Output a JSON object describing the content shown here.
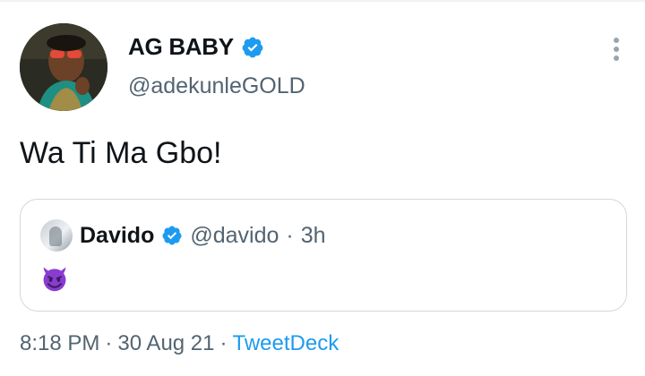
{
  "author": {
    "display_name": "AG BABY",
    "handle": "@adekunleGOLD",
    "verified": true
  },
  "tweet": {
    "text": "Wa Ti Ma Gbo!"
  },
  "quoted_tweet": {
    "display_name": "Davido",
    "handle": "@davido",
    "separator": "·",
    "time_ago": "3h",
    "verified": true,
    "body_emoji": "smiling-devil-emoji"
  },
  "meta": {
    "time": "8:18 PM",
    "dot1": "·",
    "date": "30 Aug 21",
    "dot2": "·",
    "source": "TweetDeck"
  },
  "colors": {
    "accent": "#1d9bf0",
    "secondary_text": "#536471",
    "border": "#cfd9de",
    "devil_purple": "#8a3bd0"
  },
  "icons": [
    "verified-badge-icon",
    "more-options-icon",
    "smiling-devil-emoji"
  ]
}
